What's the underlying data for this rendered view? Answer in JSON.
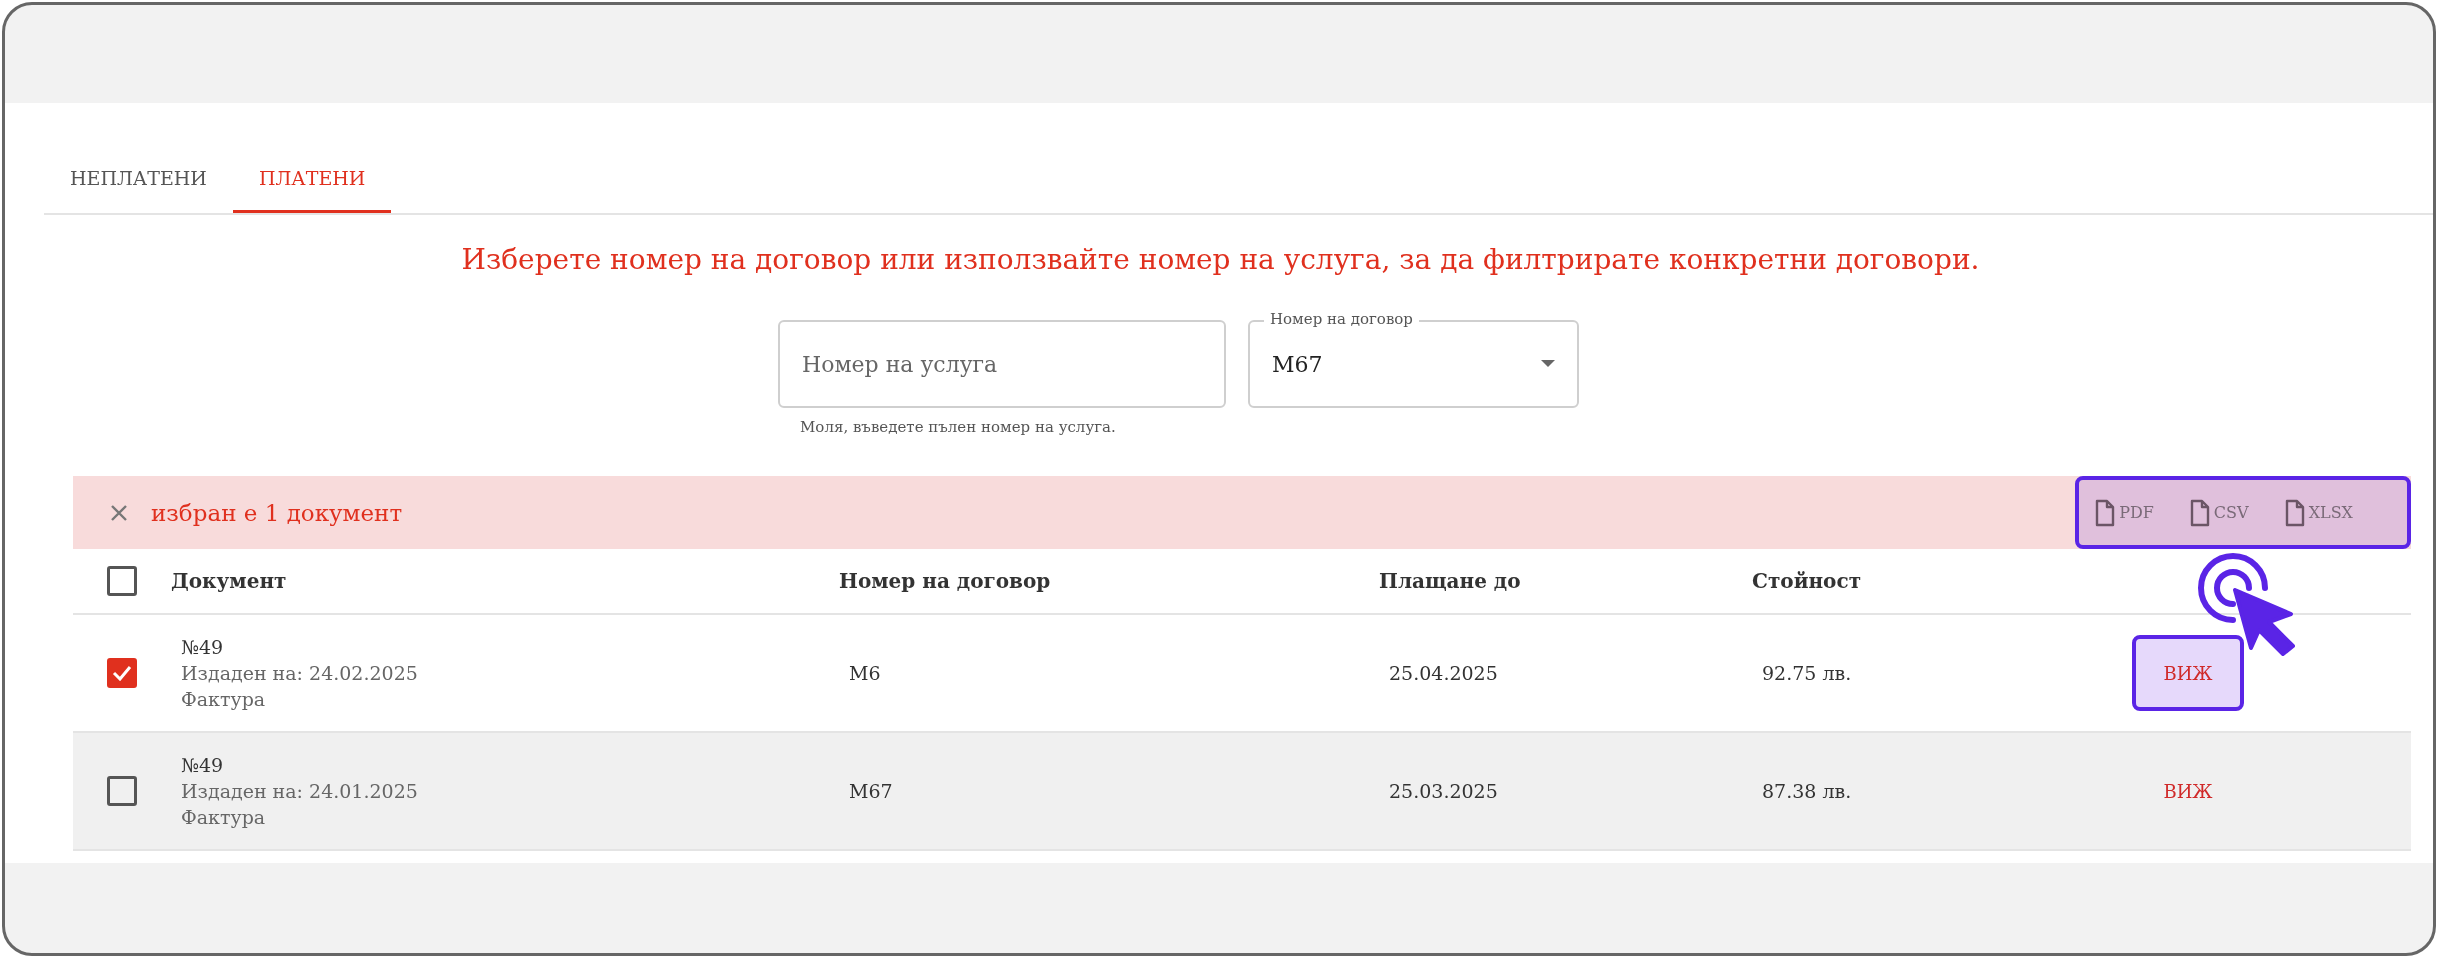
{
  "tabs": [
    {
      "label": "НЕПЛАТЕНИ",
      "selected": false
    },
    {
      "label": "ПЛАТЕНИ",
      "selected": true
    }
  ],
  "instruction": "Изберете номер на договор или използвайте номер на услуга, за да филтрирате конкретни договори.",
  "service_field": {
    "placeholder": "Номер на услуга",
    "helper": "Моля, въведете пълен номер на услуга."
  },
  "contract_select": {
    "label": "Номер на договор",
    "value": "М67"
  },
  "selection_bar": {
    "text": "избран е 1 документ",
    "exports_highlighted": true,
    "exports": [
      {
        "label": "PDF"
      },
      {
        "label": "CSV"
      },
      {
        "label": "XLSX"
      }
    ]
  },
  "table": {
    "select_all_checked": false,
    "columns": [
      "Документ",
      "Номер на договор",
      "Плащане до",
      "Стойност"
    ],
    "rows": [
      {
        "checked": true,
        "hovered": false,
        "number": "№49",
        "issued": "Издаден на: 24.02.2025",
        "type": "Фактура",
        "contract": "М6",
        "due": "25.04.2025",
        "amount": "92.75 лв.",
        "action": "ВИЖ",
        "highlighted": true
      },
      {
        "checked": false,
        "hovered": true,
        "number": "№49",
        "issued": "Издаден на: 24.01.2025",
        "type": "Фактура",
        "contract": "М67",
        "due": "25.03.2025",
        "amount": "87.38 лв.",
        "action": "ВИЖ",
        "highlighted": false
      }
    ]
  }
}
